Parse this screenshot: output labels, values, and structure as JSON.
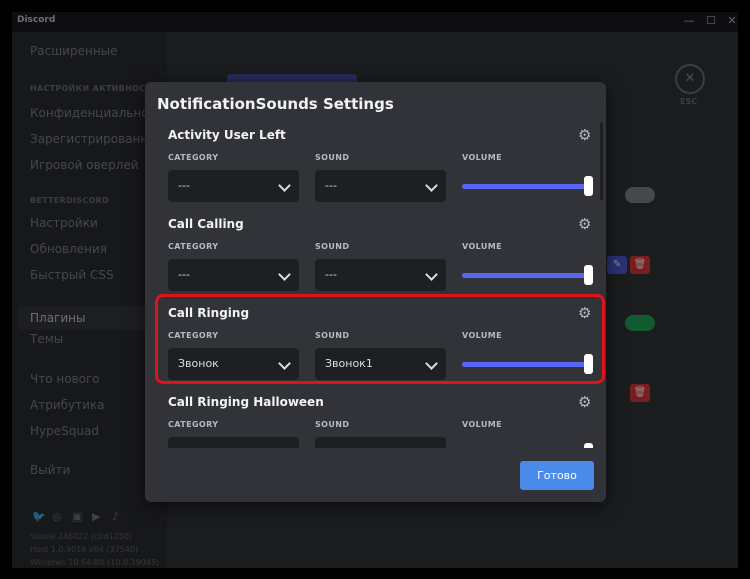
{
  "window": {
    "title": "Discord",
    "min_glyph": "—",
    "max_glyph": "☐",
    "close_glyph": "✕"
  },
  "sidebar": {
    "items_top": [
      {
        "label": "Расширенные"
      }
    ],
    "header_activity": "НАСТРОЙКИ АКТИВНОСТИ",
    "items_activity": [
      {
        "label": "Конфиденциальность"
      },
      {
        "label": "Зарегистрированные"
      },
      {
        "label": "Игровой оверлей"
      }
    ],
    "header_plugins": "BETTERDISCORD",
    "items_plugins": [
      {
        "label": "Настройки"
      },
      {
        "label": "Обновления"
      },
      {
        "label": "Быстрый CSS"
      },
      {
        "label": "Плагины"
      },
      {
        "label": "Темы"
      }
    ],
    "items_bottom": [
      {
        "label": "Что нового"
      },
      {
        "label": "Атрибутика"
      },
      {
        "label": "HypeSquad"
      }
    ],
    "logout": "Выйти",
    "version_lines": [
      "Stable 246022 (c0d1250)",
      "Host 1.0.9016 x64 (37540)",
      "Windows 10 64-Bit (10.0.19045)"
    ]
  },
  "background": {
    "esc_label": "ESC"
  },
  "modal": {
    "title": "NotificationSounds Settings",
    "columns": {
      "category": "CATEGORY",
      "sound": "SOUND",
      "volume": "VOLUME"
    },
    "items": [
      {
        "name": "Activity User Left",
        "category": "---",
        "sound": "---",
        "volume": 1.0
      },
      {
        "name": "Call Calling",
        "category": "---",
        "sound": "---",
        "volume": 1.0
      },
      {
        "name": "Call Ringing",
        "category": "Звонок",
        "sound": "Звонок1",
        "volume": 1.0
      },
      {
        "name": "Call Ringing Halloween",
        "category": "",
        "sound": "",
        "volume": 1.0
      }
    ],
    "done_label": "Готово"
  },
  "colors": {
    "accent": "#5865f2",
    "done_button": "#4a8ae8",
    "highlight": "#e0121c"
  }
}
